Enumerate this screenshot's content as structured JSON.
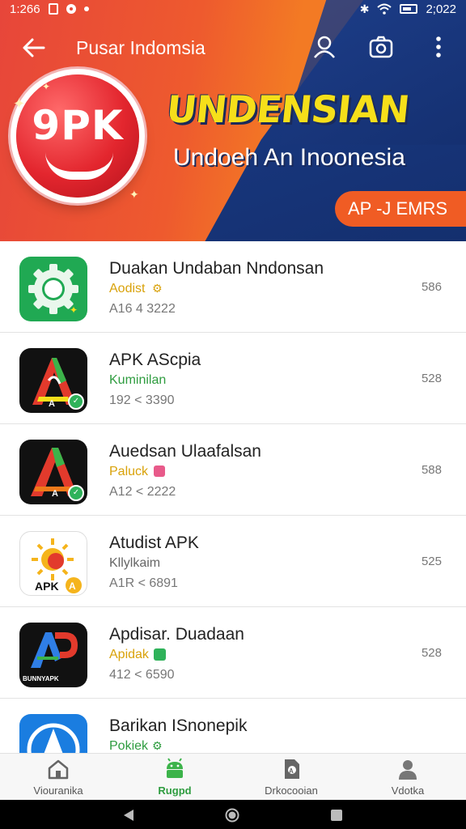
{
  "status_bar": {
    "time": "1:266",
    "clock_right": "2;022"
  },
  "header": {
    "title": "Pusar Indomsia"
  },
  "banner": {
    "logo_text": "9PK",
    "title": "UNDENSIAN",
    "subtitle": "Undoeh An Inoonesia",
    "pill_label": "AP -J EMRS"
  },
  "apps": [
    {
      "name": "Duakan Undaban Nndonsan",
      "tag": "Aodist",
      "tag_color": "#d9a20a",
      "meta": "A16 4 3222",
      "count": "586",
      "icon": "gear-icon"
    },
    {
      "name": "APK AScpia",
      "tag": "Kuminilan",
      "tag_color": "#2e9c3f",
      "meta": "192 < 3390",
      "count": "528",
      "icon": "colored-a-logo-icon"
    },
    {
      "name": "Auedsan Ulaafalsan",
      "tag": "Paluck",
      "tag_color": "#d9a20a",
      "meta": "A12 < 2222",
      "count": "588",
      "icon": "colored-a-logo-icon"
    },
    {
      "name": "Atudist APK",
      "tag": "Kllylkaim",
      "tag_color": "#666666",
      "meta": "A1R < 6891",
      "count": "525",
      "icon": "sun-apk-icon"
    },
    {
      "name": "Apdisar. Duadaan",
      "tag": "Apidak",
      "tag_color": "#d9a20a",
      "meta": "412 < 6590",
      "count": "528",
      "icon": "ap-logo-icon"
    },
    {
      "name": "Barikan ISnonepik",
      "tag": "Pokiek",
      "tag_color": "#2e9c3f",
      "meta": "",
      "count": "",
      "icon": "navigation-a-icon"
    }
  ],
  "bottom_nav": [
    {
      "label": "Viouranika",
      "icon": "home-icon",
      "active": false
    },
    {
      "label": "Rugpd",
      "icon": "android-icon",
      "active": true
    },
    {
      "label": "Drkocooian",
      "icon": "apk-file-icon",
      "active": false
    },
    {
      "label": "Vdotka",
      "icon": "profile-icon",
      "active": false
    }
  ],
  "colors": {
    "accent": "#2e9c3f",
    "banner_red": "#e7463a",
    "banner_navy": "#1c3f8e",
    "banner_yellow": "#f6df1a"
  }
}
